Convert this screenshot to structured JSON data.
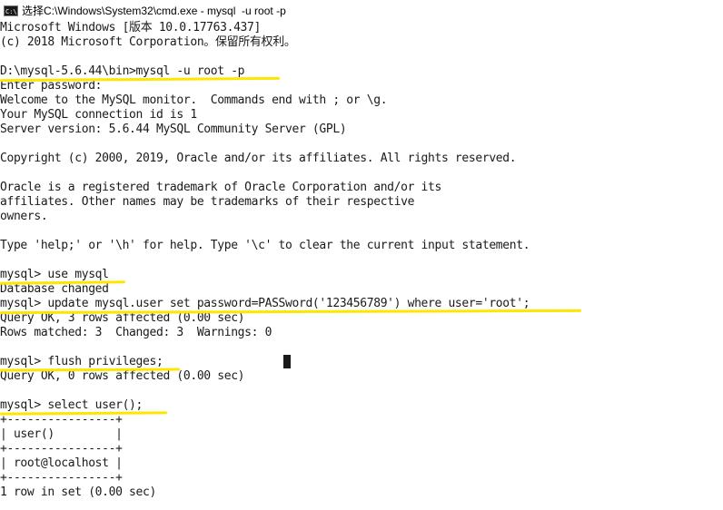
{
  "window": {
    "title": "选择C:\\Windows\\System32\\cmd.exe - mysql  -u root -p",
    "icon_label": "C:\\",
    "icon": "console-icon"
  },
  "console": {
    "lines": [
      "Microsoft Windows [版本 10.0.17763.437]",
      "(c) 2018 Microsoft Corporation。保留所有权利。",
      "",
      "D:\\mysql-5.6.44\\bin>mysql -u root -p",
      "Enter password:",
      "Welcome to the MySQL monitor.  Commands end with ; or \\g.",
      "Your MySQL connection id is 1",
      "Server version: 5.6.44 MySQL Community Server (GPL)",
      "",
      "Copyright (c) 2000, 2019, Oracle and/or its affiliates. All rights reserved.",
      "",
      "Oracle is a registered trademark of Oracle Corporation and/or its",
      "affiliates. Other names may be trademarks of their respective",
      "owners.",
      "",
      "Type 'help;' or '\\h' for help. Type '\\c' to clear the current input statement.",
      "",
      "mysql> use mysql",
      "Database changed",
      "mysql> update mysql.user set password=PASSword('123456789') where user='root';",
      "Query OK, 3 rows affected (0.00 sec)",
      "Rows matched: 3  Changed: 3  Warnings: 0",
      "",
      "mysql> flush privileges;",
      "Query OK, 0 rows affected (0.00 sec)",
      "",
      "mysql> select user();",
      "+----------------+",
      "| user()         |",
      "+----------------+",
      "| root@localhost |",
      "+----------------+",
      "1 row in set (0.00 sec)"
    ],
    "highlight_color": "#ffe600",
    "text_color": "#1a1a1a",
    "background_color": "#ffffff"
  }
}
